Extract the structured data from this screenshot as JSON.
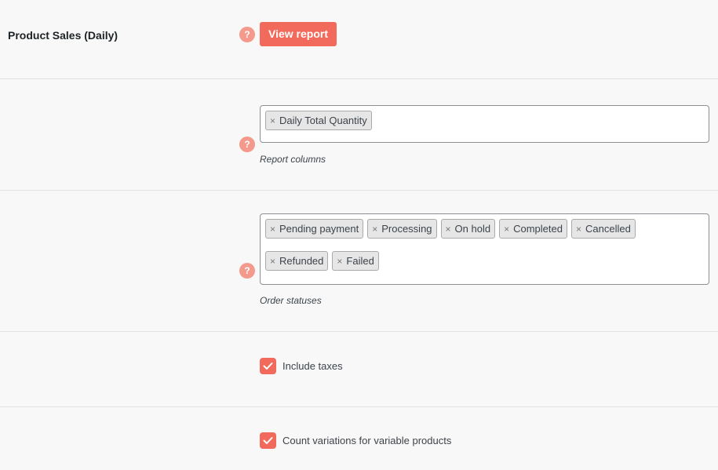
{
  "product_sales": {
    "label": "Product Sales (Daily)",
    "help": "?",
    "view_report_label": "View report"
  },
  "report_columns": {
    "help": "?",
    "chips": [
      "Daily Total Quantity"
    ],
    "description": "Report columns"
  },
  "order_statuses": {
    "help": "?",
    "chips": [
      "Pending payment",
      "Processing",
      "On hold",
      "Completed",
      "Cancelled",
      "Refunded",
      "Failed"
    ],
    "description": "Order statuses"
  },
  "chip_remove_glyph": "×",
  "include_taxes": {
    "label": "Include taxes",
    "checked": true
  },
  "count_variations": {
    "label": "Count variations for variable products",
    "checked": true
  },
  "colors": {
    "accent": "#f26a5b",
    "help_icon": "#f39a8c",
    "background": "#f8f8f8",
    "divider": "#e2e2e2"
  }
}
